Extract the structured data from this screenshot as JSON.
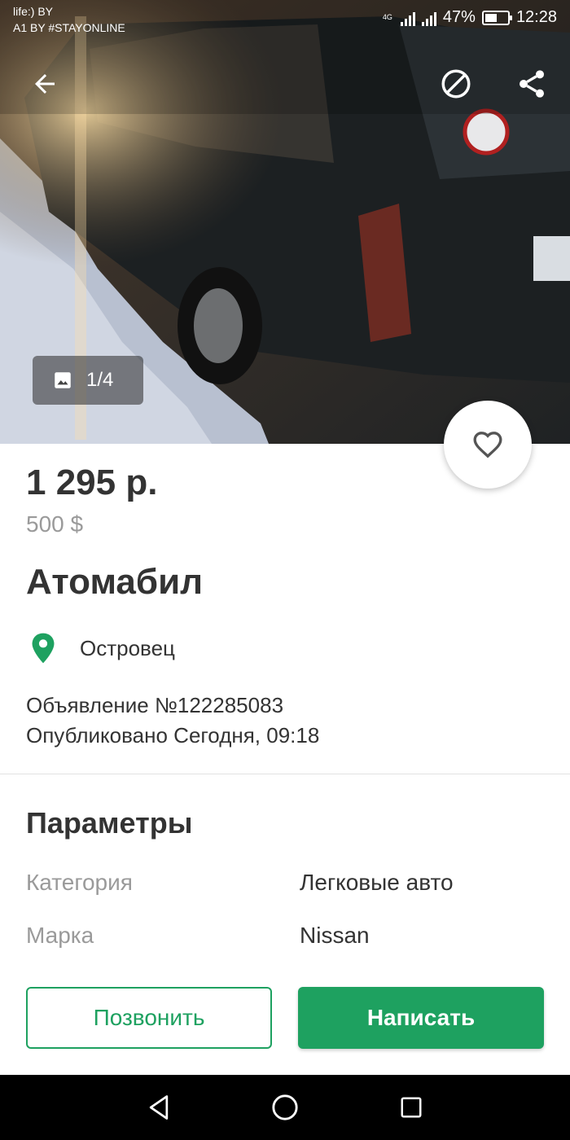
{
  "status_bar": {
    "carrier_line1": "life:) BY",
    "carrier_line2": "A1 BY #STAYONLINE",
    "network_label": "4G",
    "battery_percent": "47%",
    "time": "12:28"
  },
  "gallery": {
    "counter": "1/4"
  },
  "listing": {
    "price": "1 295 р.",
    "price_usd": "500 $",
    "title": "Атомабил",
    "location": "Островец",
    "ad_number": "Объявление №122285083",
    "published": "Опубликовано Сегодня, 09:18"
  },
  "params": {
    "heading": "Параметры",
    "rows": [
      {
        "key": "Категория",
        "value": "Легковые авто"
      },
      {
        "key": "Марка",
        "value": "Nissan"
      }
    ]
  },
  "actions": {
    "call_label": "Позвонить",
    "write_label": "Написать"
  },
  "colors": {
    "accent": "#1ea160",
    "text": "#333333",
    "muted": "#9a9a9a"
  },
  "icons": [
    "back-arrow-icon",
    "block-icon",
    "share-icon",
    "image-icon",
    "heart-icon",
    "location-pin-icon",
    "nav-back-icon",
    "nav-home-icon",
    "nav-recent-icon"
  ]
}
